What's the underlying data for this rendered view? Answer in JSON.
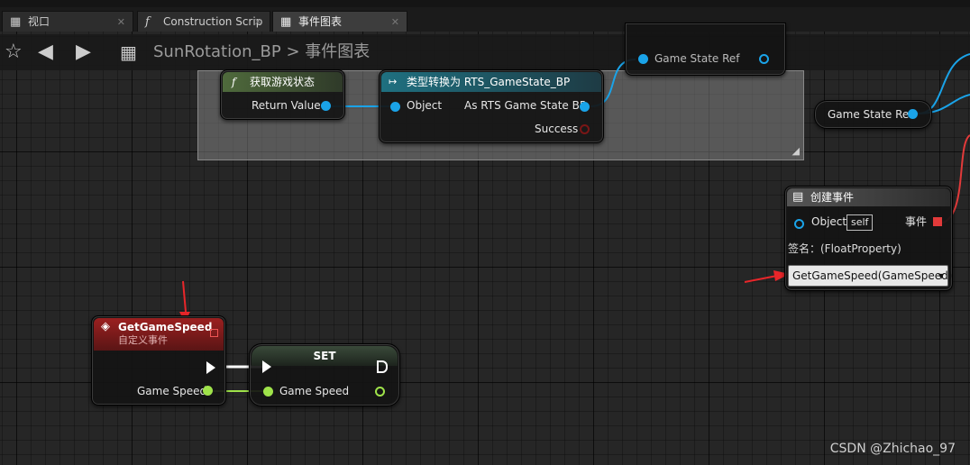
{
  "tabs": [
    {
      "label": "视口",
      "icon": "viewport-icon"
    },
    {
      "label": "Construction Scrip",
      "icon": "function-icon"
    },
    {
      "label": "事件图表",
      "icon": "event-graph-icon"
    }
  ],
  "breadcrumb": {
    "blueprint": "SunRotation_BP",
    "separator": ">",
    "graph": "事件图表"
  },
  "nodes": {
    "get_game_state": {
      "title": "获取游戏状态",
      "return_label": "Return Value"
    },
    "cast": {
      "title": "类型转换为 RTS_GameState_BP",
      "object_label": "Object",
      "as_label": "As RTS Game State BP",
      "success_label": "Success"
    },
    "top_partial": {
      "pin_label": "Game State Ref"
    },
    "game_state_ref": {
      "label": "Game State Ref"
    },
    "create_event": {
      "title": "创建事件",
      "object_label": "Object",
      "self_label": "self",
      "event_label": "事件",
      "signature": "签名：(FloatProperty)",
      "selected_function": "GetGameSpeed(GameSpeed)"
    },
    "custom_event": {
      "title": "GetGameSpeed",
      "subtitle": "自定义事件",
      "pin_label": "Game Speed"
    },
    "set": {
      "title": "SET",
      "pin_label": "Game Speed"
    }
  },
  "colors": {
    "object_pin": "#1aa3e8",
    "float_pin": "#9fe34a",
    "event_header": "#8c1f1f",
    "cast_header": "#1f6f7a",
    "function_header": "#4d6b3a",
    "arrow": "#e8262a"
  },
  "watermark": "CSDN @Zhichao_97"
}
